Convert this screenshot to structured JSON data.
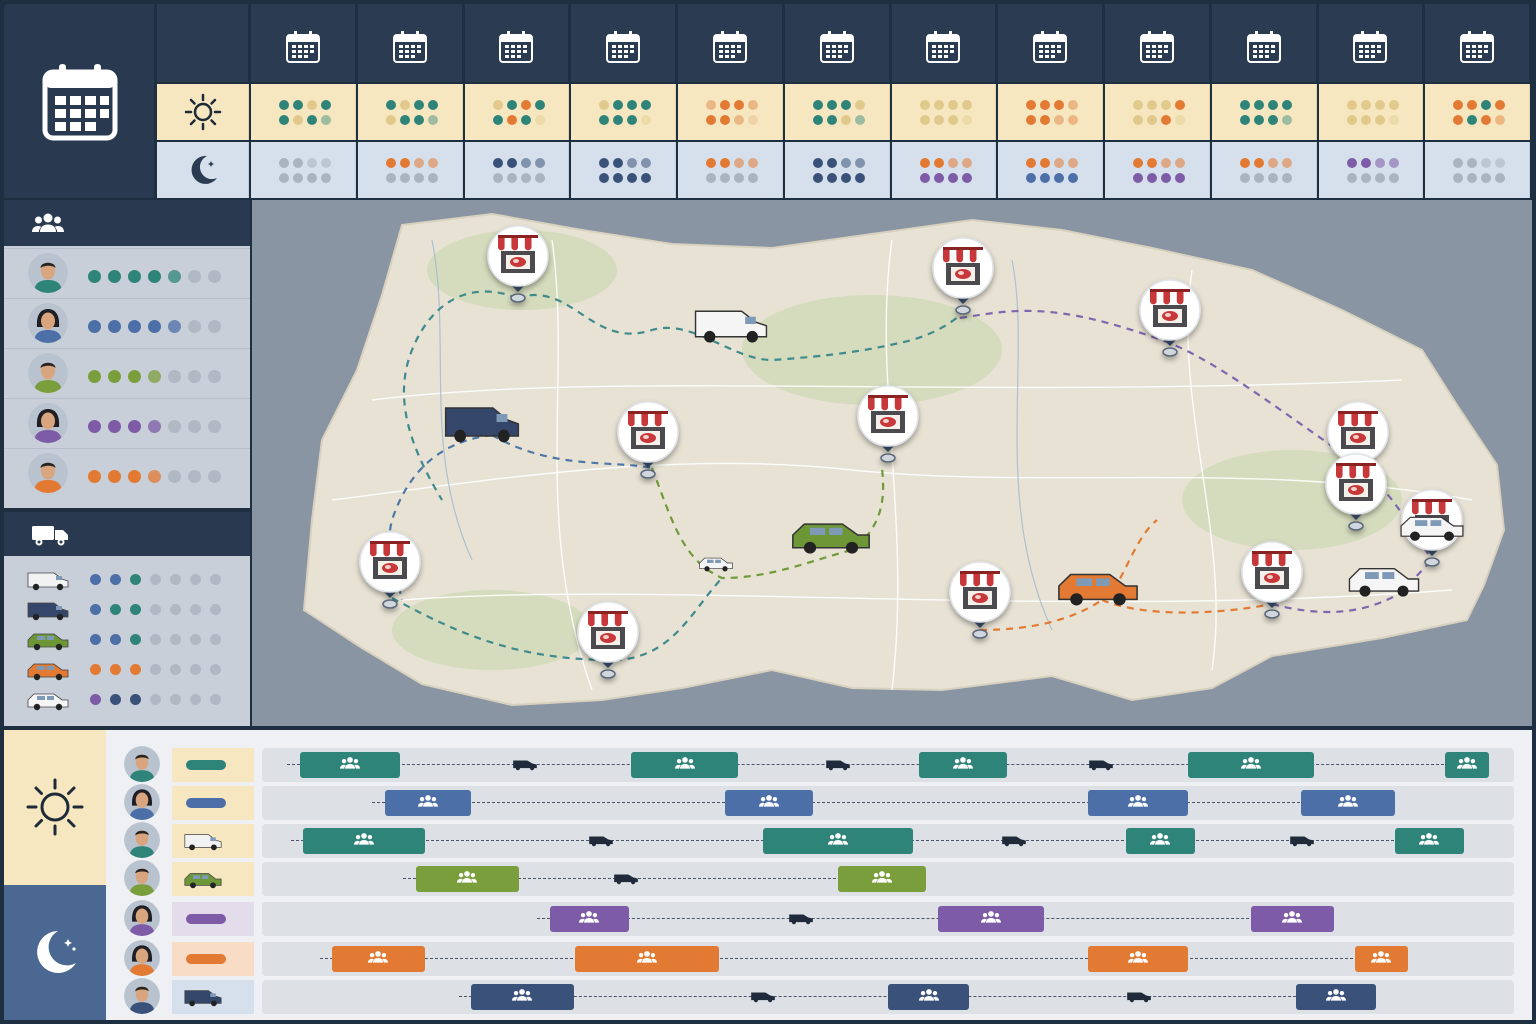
{
  "colors": {
    "header_dark": "#293a50",
    "day_band": "#f6e7c1",
    "night_band": "#d6dfec",
    "teal": "#2f8479",
    "blue": "#4d6fa7",
    "green": "#7b9e3c",
    "purple": "#7d5ba6",
    "orange": "#e37a33",
    "navy": "#3a5279",
    "store_red": "#c8393a"
  },
  "icons": {
    "header": "calendar-icon",
    "day": "sun-icon",
    "night": "moon-icon",
    "staff": "people-group-icon",
    "fleet": "truck-icon",
    "stop": "butcher-shop-pin-icon",
    "shift": "team-icon"
  },
  "calendar_columns": 12,
  "staff": [
    {
      "color": "teal",
      "dots_filled": 5
    },
    {
      "color": "blue",
      "dots_filled": 5
    },
    {
      "color": "green",
      "dots_filled": 4
    },
    {
      "color": "purple",
      "dots_filled": 4
    },
    {
      "color": "orange",
      "dots_filled": 4
    }
  ],
  "vehicles": [
    {
      "type": "white-van",
      "color": "#f2f2f2"
    },
    {
      "type": "navy-van",
      "color": "#34476a"
    },
    {
      "type": "green-suv",
      "color": "#6d9636"
    },
    {
      "type": "orange-car",
      "color": "#e37a33"
    },
    {
      "type": "white-suv",
      "color": "#f5f5f5"
    }
  ],
  "schedule_rows": [
    {
      "color": "teal",
      "vehicle": "",
      "shifts": [
        [
          0.03,
          0.11
        ],
        [
          0.295,
          0.38
        ],
        [
          0.525,
          0.595
        ],
        [
          0.74,
          0.84
        ],
        [
          0.945,
          0.98
        ]
      ],
      "trips": [
        0.2,
        0.45,
        0.66
      ]
    },
    {
      "color": "blue",
      "vehicle": "",
      "shifts": [
        [
          0.098,
          0.167
        ],
        [
          0.37,
          0.44
        ],
        [
          0.66,
          0.74
        ],
        [
          0.83,
          0.905
        ]
      ],
      "trips": []
    },
    {
      "color": "teal",
      "vehicle": "white-van",
      "shifts": [
        [
          0.033,
          0.13
        ],
        [
          0.4,
          0.52
        ],
        [
          0.69,
          0.745
        ],
        [
          0.905,
          0.96
        ]
      ],
      "trips": [
        0.26,
        0.59,
        0.82
      ]
    },
    {
      "color": "green",
      "vehicle": "green-suv",
      "shifts": [
        [
          0.123,
          0.205
        ],
        [
          0.46,
          0.53
        ]
      ],
      "trips": [
        0.28
      ]
    },
    {
      "color": "purple",
      "vehicle": "",
      "shifts": [
        [
          0.23,
          0.293
        ],
        [
          0.54,
          0.625
        ],
        [
          0.79,
          0.856
        ]
      ],
      "trips": [
        0.42
      ]
    },
    {
      "color": "orange",
      "vehicle": "",
      "shifts": [
        [
          0.056,
          0.13
        ],
        [
          0.25,
          0.365
        ],
        [
          0.66,
          0.74
        ],
        [
          0.873,
          0.915
        ]
      ],
      "trips": []
    },
    {
      "color": "navy",
      "vehicle": "navy-van",
      "shifts": [
        [
          0.167,
          0.249
        ],
        [
          0.5,
          0.565
        ],
        [
          0.826,
          0.89
        ]
      ],
      "trips": [
        0.39,
        0.69
      ]
    }
  ],
  "map_stops": [
    {
      "id": "s1",
      "name": "stop-1"
    },
    {
      "id": "s2",
      "name": "stop-2"
    },
    {
      "id": "s3",
      "name": "stop-3"
    },
    {
      "id": "s4",
      "name": "stop-4"
    },
    {
      "id": "s5",
      "name": "stop-5"
    },
    {
      "id": "s6",
      "name": "stop-6"
    },
    {
      "id": "s7",
      "name": "stop-7"
    },
    {
      "id": "s8",
      "name": "stop-8"
    },
    {
      "id": "s9",
      "name": "stop-9"
    },
    {
      "id": "s10",
      "name": "stop-10"
    },
    {
      "id": "s11",
      "name": "stop-11"
    },
    {
      "id": "s12",
      "name": "stop-12"
    },
    {
      "id": "s13",
      "name": "stop-13"
    }
  ]
}
